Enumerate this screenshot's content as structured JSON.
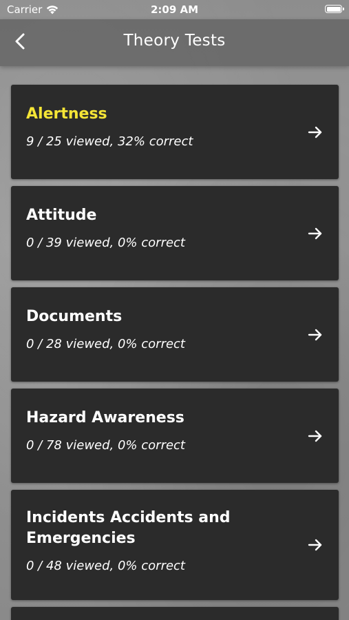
{
  "status_bar": {
    "carrier": "Carrier",
    "time": "2:09 AM",
    "wifi_icon": "wifi-icon",
    "battery_icon": "battery-icon"
  },
  "nav": {
    "title": "Theory Tests",
    "back_icon": "chevron-left-icon"
  },
  "colors": {
    "card_bg": "#2b2b2b",
    "highlight_title": "#f5e536",
    "text": "#ffffff"
  },
  "topics": [
    {
      "title": "Alertness",
      "progress": "9 / 25 viewed, 32% correct",
      "highlighted": true,
      "icon": "arrow-right-icon"
    },
    {
      "title": "Attitude",
      "progress": "0 / 39 viewed, 0% correct",
      "highlighted": false,
      "icon": "arrow-right-icon"
    },
    {
      "title": "Documents",
      "progress": "0 / 28 viewed, 0% correct",
      "highlighted": false,
      "icon": "arrow-right-icon"
    },
    {
      "title": "Hazard Awareness",
      "progress": "0 / 78 viewed, 0% correct",
      "highlighted": false,
      "icon": "arrow-right-icon"
    },
    {
      "title": "Incidents Accidents and Emergencies",
      "progress": "0 / 48 viewed, 0% correct",
      "highlighted": false,
      "icon": "arrow-right-icon"
    }
  ]
}
